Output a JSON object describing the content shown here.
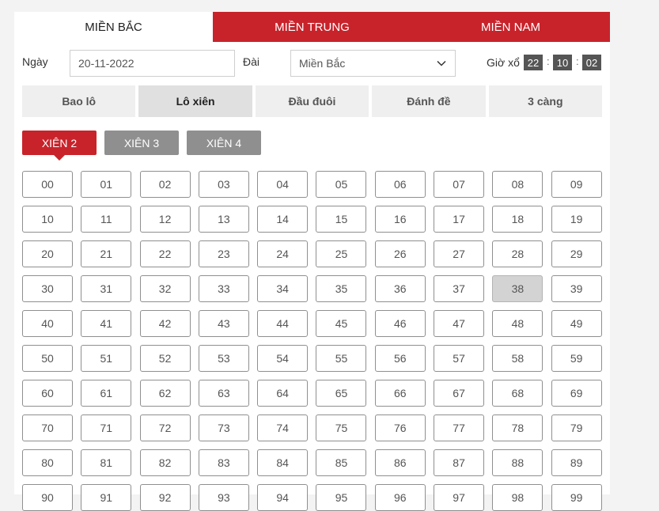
{
  "region_tabs": [
    {
      "label": "MIỀN BẮC",
      "active": true
    },
    {
      "label": "MIỀN TRUNG",
      "active": false
    },
    {
      "label": "MIỀN NAM",
      "active": false
    }
  ],
  "form": {
    "date_label": "Ngày",
    "date_value": "20-11-2022",
    "station_label": "Đài",
    "station_value": "Miền Bắc",
    "time_label": "Giờ xổ",
    "time_hour": "22",
    "time_minute": "10",
    "time_second": "02",
    "time_separator": ":"
  },
  "type_tabs": [
    {
      "label": "Bao lô",
      "active": false
    },
    {
      "label": "Lô xiên",
      "active": true
    },
    {
      "label": "Đầu đuôi",
      "active": false
    },
    {
      "label": "Đánh đề",
      "active": false
    },
    {
      "label": "3 càng",
      "active": false
    }
  ],
  "xien_tabs": [
    {
      "label": "XIÊN 2",
      "active": true
    },
    {
      "label": "XIÊN 3",
      "active": false
    },
    {
      "label": "XIÊN 4",
      "active": false
    }
  ],
  "numbers": [
    "00",
    "01",
    "02",
    "03",
    "04",
    "05",
    "06",
    "07",
    "08",
    "09",
    "10",
    "11",
    "12",
    "13",
    "14",
    "15",
    "16",
    "17",
    "18",
    "19",
    "20",
    "21",
    "22",
    "23",
    "24",
    "25",
    "26",
    "27",
    "28",
    "29",
    "30",
    "31",
    "32",
    "33",
    "34",
    "35",
    "36",
    "37",
    "38",
    "39",
    "40",
    "41",
    "42",
    "43",
    "44",
    "45",
    "46",
    "47",
    "48",
    "49",
    "50",
    "51",
    "52",
    "53",
    "54",
    "55",
    "56",
    "57",
    "58",
    "59",
    "60",
    "61",
    "62",
    "63",
    "64",
    "65",
    "66",
    "67",
    "68",
    "69",
    "70",
    "71",
    "72",
    "73",
    "74",
    "75",
    "76",
    "77",
    "78",
    "79",
    "80",
    "81",
    "82",
    "83",
    "84",
    "85",
    "86",
    "87",
    "88",
    "89",
    "90",
    "91",
    "92",
    "93",
    "94",
    "95",
    "96",
    "97",
    "98",
    "99"
  ],
  "selected_numbers": [
    "38"
  ],
  "colors": {
    "accent": "#c8232b",
    "inactive_xien": "#8f8f8f",
    "time_box": "#555555"
  }
}
